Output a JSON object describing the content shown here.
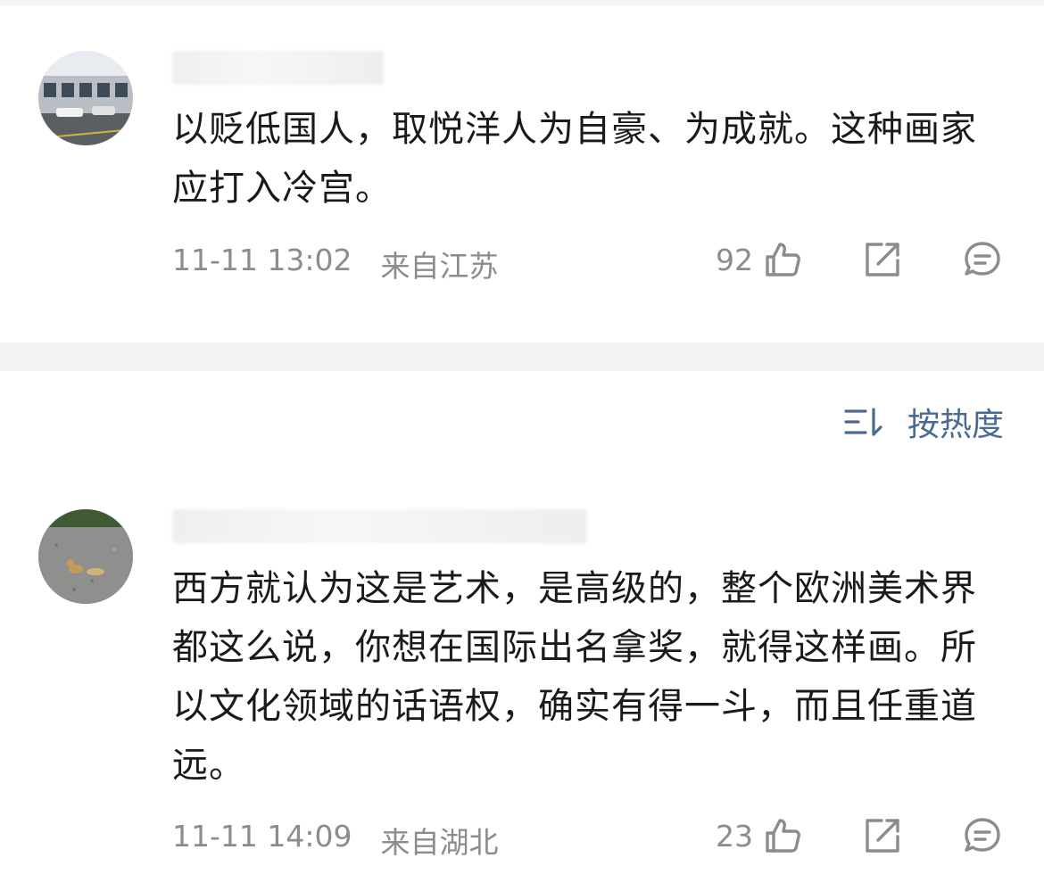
{
  "comments": [
    {
      "text": "以贬低国人，取悦洋人为自豪、为成就。这种画家应打入冷宫。",
      "time": "11-11 13:02",
      "location": "来自江苏",
      "likes": "92"
    },
    {
      "text": "西方就认为这是艺术，是高级的，整个欧洲美术界都这么说，你想在国际出名拿奖，就得这样画。所以文化领域的话语权，确实有得一斗，而且任重道远。",
      "time": "11-11 14:09",
      "location": "来自湖北",
      "likes": "23"
    }
  ],
  "sort": {
    "label": "按热度"
  },
  "icons": {
    "like": "thumbs-up-icon",
    "repost": "share-icon",
    "reply": "comment-icon",
    "sort": "sort-icon"
  },
  "colors": {
    "meta": "#8c8c8c",
    "sort": "#4a6a93",
    "divider": "#f2f2f2"
  }
}
